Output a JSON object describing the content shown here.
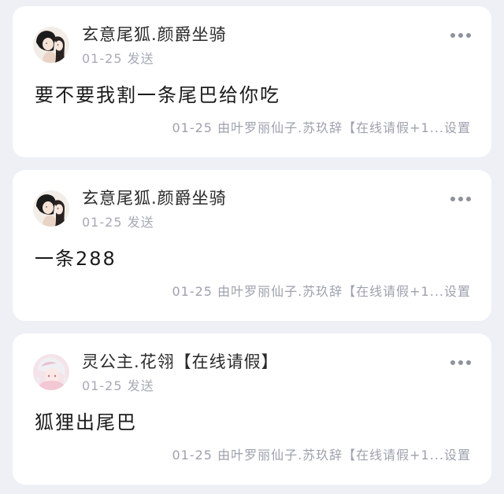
{
  "posts": [
    {
      "author": "玄意尾狐.颜爵坐骑",
      "time": "01-25 发送",
      "content": "要不要我割一条尾巴给你吃",
      "meta": "01-25 由叶罗丽仙子.苏玖辞【在线请假+1...设置",
      "avatar_icon": "couple-avatar-icon"
    },
    {
      "author": "玄意尾狐.颜爵坐骑",
      "time": "01-25 发送",
      "content": "一条288",
      "meta": "01-25 由叶罗丽仙子.苏玖辞【在线请假+1...设置",
      "avatar_icon": "couple-avatar-icon"
    },
    {
      "author": "灵公主.花翎【在线请假】",
      "time": "01-25 发送",
      "content": "狐狸出尾巴",
      "meta": "01-25 由叶罗丽仙子.苏玖辞【在线请假+1...设置",
      "avatar_icon": "anime-girl-avatar-icon"
    }
  ],
  "colors": {
    "background": "#eef0f6",
    "card": "#ffffff",
    "secondary_text": "#a7aab6"
  }
}
